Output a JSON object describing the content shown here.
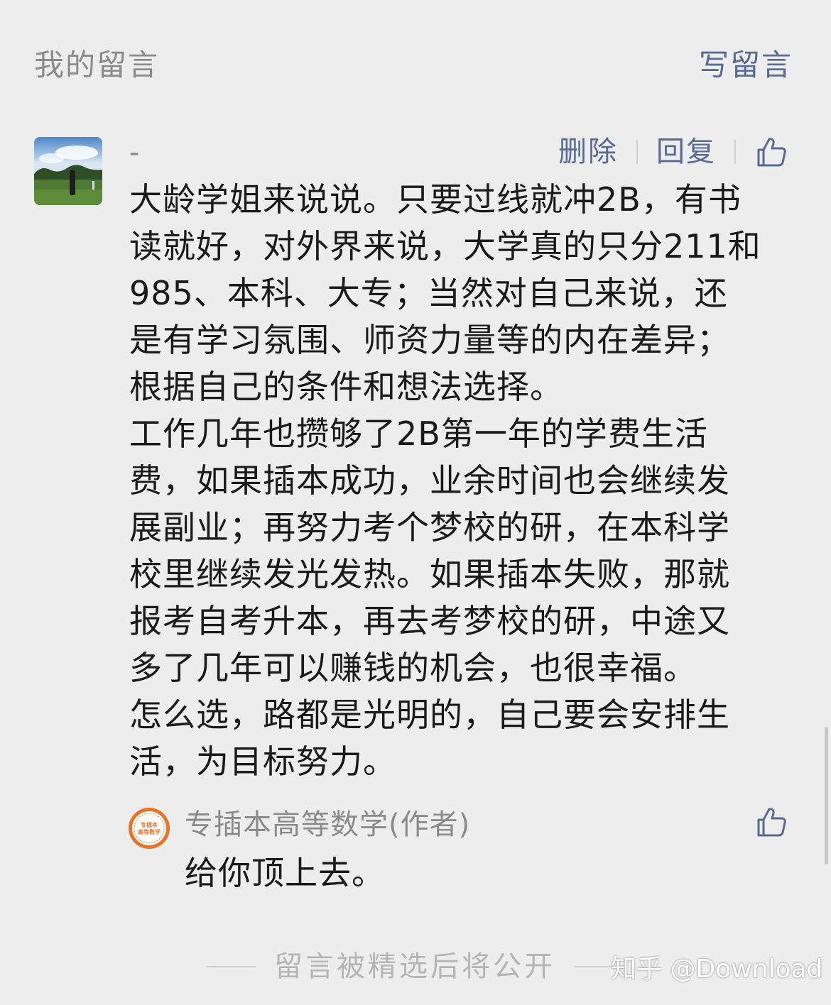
{
  "header": {
    "title": "我的留言",
    "write_label": "写留言"
  },
  "comment": {
    "nickname": "-",
    "actions": {
      "delete_label": "删除",
      "reply_label": "回复"
    },
    "lines": [
      "大龄学姐来说说。只要过线就冲2B，有书",
      "读就好，对外界来说，大学真的只分211和",
      "985、本科、大专；当然对自己来说，还",
      "是有学习氛围、师资力量等的内在差异；",
      "根据自己的条件和想法选择。",
      "工作几年也攒够了2B第一年的学费生活",
      "费，如果插本成功，业余时间也会继续发",
      "展副业；再努力考个梦校的研，在本科学",
      "校里继续发光发热。如果插本失败，那就",
      "报考自考升本，再去考梦校的研，中途又",
      "多了几年可以赚钱的机会，也很幸福。",
      "怎么选，路都是光明的，自己要会安排生",
      "活，为目标努力。"
    ]
  },
  "reply": {
    "author": "专插本高等数学(作者)",
    "text": "给你顶上去。",
    "avatar_text_top": "专插本",
    "avatar_text_bottom": "高等数学"
  },
  "footer": {
    "text": "留言被精选后将公开"
  },
  "watermark": {
    "text": "知乎 @Download"
  },
  "colors": {
    "background": "#ededed",
    "link": "#576b95",
    "muted": "#8a8a8a",
    "body_text": "#1a1a1a",
    "avatar_orange": "#e8742a"
  },
  "icons": {
    "like": "thumbs-up-icon"
  }
}
